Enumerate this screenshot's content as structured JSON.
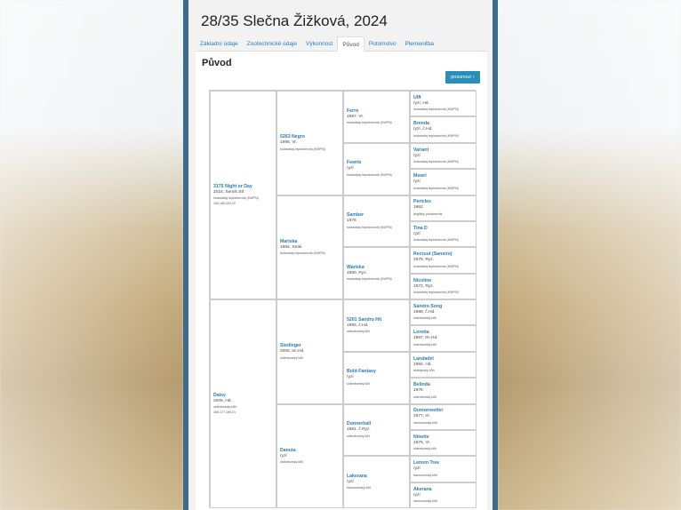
{
  "page": {
    "title": "28/35 Slečna Žižková, 2024",
    "tabs": [
      {
        "label": "Základní údaje"
      },
      {
        "label": "Zootechnické údaje"
      },
      {
        "label": "Výkonnost"
      },
      {
        "label": "Původ"
      },
      {
        "label": "Potomstvo"
      },
      {
        "label": "Plemenitba"
      }
    ],
    "active_tab": "Původ",
    "section_heading": "Původ",
    "shift_button": "posunout",
    "shift_icon": "chevron-right-icon",
    "accent_color": "#2a8fb8"
  },
  "pedigree": {
    "sire": {
      "name": "3175 Night or Day",
      "line1": "2015, Šemík Stř.",
      "breed": "holandský teplokrevník (KWPN)",
      "extra": "183,169,202,22"
    },
    "dam": {
      "name": "Daisy",
      "line1": "2005, Hd.",
      "breed": "oldenburský kůň",
      "extra": "160,177,169,21"
    },
    "gen2": [
      {
        "name": "5263 Negro",
        "line1": "1995, Vr.",
        "breed": "holandský teplokrevník (KWPN)"
      },
      {
        "name": "Mariska",
        "line1": "1994, Strak",
        "breed": "holandský teplokrevník (KWPN)"
      },
      {
        "name": "Stedinger",
        "line1": "2000, tm.Hd.",
        "breed": "oldenburský kůň"
      },
      {
        "name": "Danuta",
        "line1": "ryzí",
        "breed": "oldenburský kůň"
      }
    ],
    "gen3": [
      {
        "name": "Ferro",
        "line1": "1987, Vr.",
        "breed": "holandský teplokrevník (KWPN)"
      },
      {
        "name": "Fewrie",
        "line1": "ryzí",
        "breed": "holandský teplokrevník (KWPN)"
      },
      {
        "name": "Samber",
        "line1": "1976",
        "breed": "holandský teplokrevník (KWPN)"
      },
      {
        "name": "Wariska",
        "line1": "1980, Ryz.",
        "breed": "holandský teplokrevník (KWPN)"
      },
      {
        "name": "5201 Sandro Hit",
        "line1": "1993, č.Hd.",
        "breed": "oldenburský kůň"
      },
      {
        "name": "Bold-Fantasy",
        "line1": "ryzí",
        "breed": "oldenburský kůň"
      },
      {
        "name": "Donnerhall",
        "line1": "1981, č.Ryz.",
        "breed": "oldenburský kůň"
      },
      {
        "name": "Lakerana",
        "line1": "ryzí",
        "breed": "hannoverský kůň"
      }
    ],
    "gen4": [
      {
        "name": "Ulft",
        "line1": "ryzí, Hd.",
        "breed": "holandský teplokrevník (KWPN)"
      },
      {
        "name": "Brenda",
        "line1": "ryzí, č.Hd.",
        "breed": "holandský teplokrevník (KWPN)"
      },
      {
        "name": "Variant",
        "line1": "ryzí",
        "breed": "holandský teplokrevník (KWPN)"
      },
      {
        "name": "Mewri",
        "line1": "ryzí",
        "breed": "holandský teplokrevník (KWPN)"
      },
      {
        "name": "Pericles",
        "line1": "1962",
        "breed": "anglický plnokrevník"
      },
      {
        "name": "Tina D",
        "line1": "ryzí",
        "breed": "holandský teplokrevník (KWPN)"
      },
      {
        "name": "Recruut (Sansiro)",
        "line1": "1975, Ryz.",
        "breed": "holandský teplokrevník (KWPN)"
      },
      {
        "name": "Nicoline",
        "line1": "1972, Ryz.",
        "breed": "holandský teplokrevník (KWPN)"
      },
      {
        "name": "Sandro Song",
        "line1": "1988, č.Hd.",
        "breed": "oldenburský kůň"
      },
      {
        "name": "Loretta",
        "line1": "1987, tm.Hd.",
        "breed": "oldenburský kůň"
      },
      {
        "name": "Landadel",
        "line1": "1982, Hd.",
        "breed": "holštýnský kůň"
      },
      {
        "name": "Belinda",
        "line1": "1976",
        "breed": "oldenburský kůň"
      },
      {
        "name": "Donnerwetter",
        "line1": "1977, Vr.",
        "breed": "hannoverský kůň"
      },
      {
        "name": "Ninette",
        "line1": "1976, Vr.",
        "breed": "oldenburský kůň"
      },
      {
        "name": "Lemon Tree",
        "line1": "ryzí",
        "breed": "hannoverský kůň"
      },
      {
        "name": "Akerana",
        "line1": "ryzí",
        "breed": "hannoverský kůň"
      }
    ]
  }
}
